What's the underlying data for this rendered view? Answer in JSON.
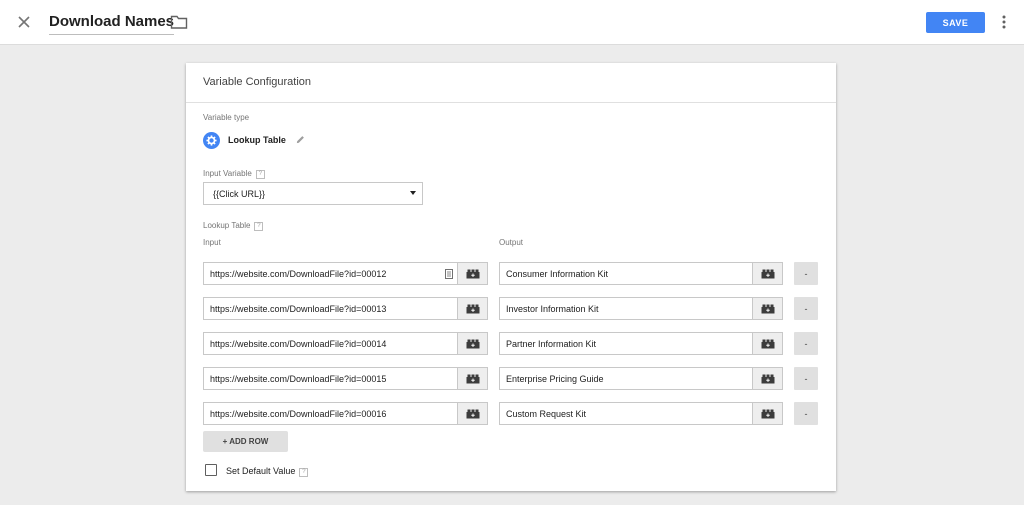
{
  "header": {
    "title": "Download Names",
    "save_label": "SAVE"
  },
  "icons": {
    "close": "close-icon",
    "folder": "folder-icon",
    "more": "more-vert-icon",
    "variable_type": "settings-gear-icon",
    "edit": "pencil-icon",
    "picker": "lego-brick-icon",
    "field": "document-icon"
  },
  "colors": {
    "accent": "#4285f4",
    "background": "#ececec"
  },
  "card": {
    "title": "Variable Configuration",
    "variable_type_label": "Variable type",
    "variable_type_name": "Lookup Table",
    "input_variable_label": "Input Variable",
    "input_variable_value": "{{Click URL}}",
    "help_glyph": "?",
    "lookup_table_label": "Lookup Table",
    "input_col": "Input",
    "output_col": "Output",
    "remove_label": "-",
    "add_row_label": "+ ADD ROW",
    "default_value_label": "Set Default Value"
  },
  "rows": [
    {
      "input": "https://website.com/DownloadFile?id=00012",
      "output": "Consumer Information Kit"
    },
    {
      "input": "https://website.com/DownloadFile?id=00013",
      "output": "Investor Information Kit"
    },
    {
      "input": "https://website.com/DownloadFile?id=00014",
      "output": "Partner Information Kit"
    },
    {
      "input": "https://website.com/DownloadFile?id=00015",
      "output": "Enterprise Pricing Guide"
    },
    {
      "input": "https://website.com/DownloadFile?id=00016",
      "output": "Custom Request Kit"
    }
  ]
}
